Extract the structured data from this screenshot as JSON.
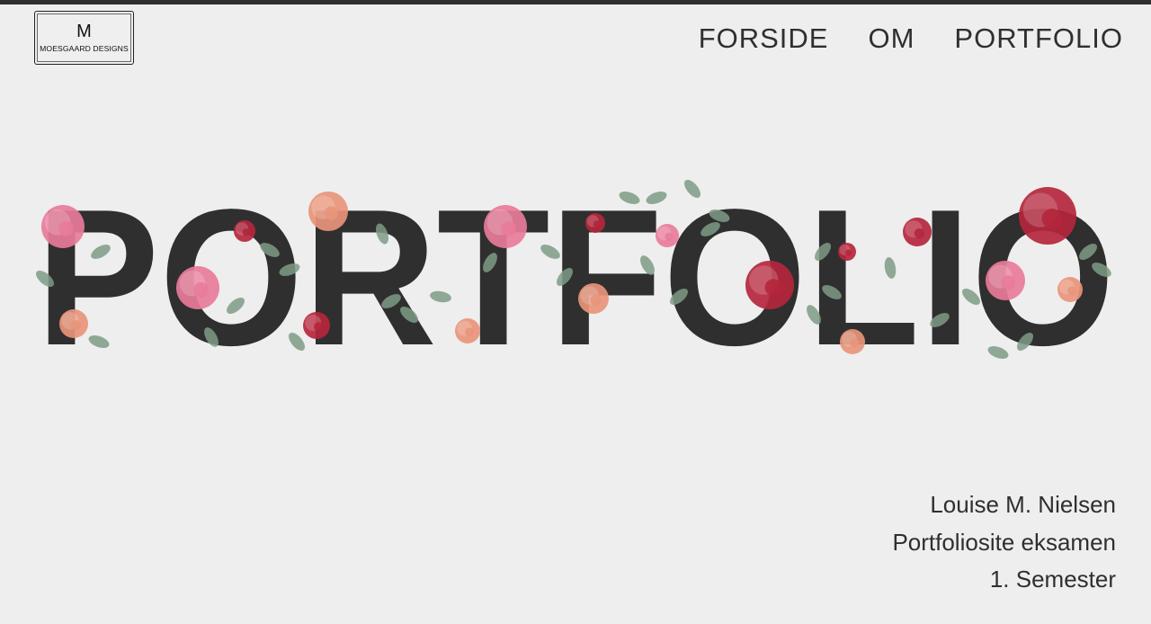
{
  "header": {
    "logo": {
      "mark": "M",
      "text": "MOESGAARD DESIGNS"
    },
    "nav": [
      {
        "label": "FORSIDE"
      },
      {
        "label": "OM"
      },
      {
        "label": "PORTFOLIO"
      }
    ]
  },
  "hero": {
    "title": "PORTFOLIO",
    "color": "#2f2f2f",
    "decoration_icon": "watercolor-flowers"
  },
  "info": {
    "name": "Louise M. Nielsen",
    "subtitle": "Portfoliosite eksamen",
    "semester": "1. Semester"
  },
  "colors": {
    "background": "#eeeeee",
    "text": "#2f2f2f",
    "flower_pink": "#e87b9a",
    "flower_red": "#b5263c",
    "flower_peach": "#e8957a",
    "leaf_green": "#7e9b86"
  }
}
